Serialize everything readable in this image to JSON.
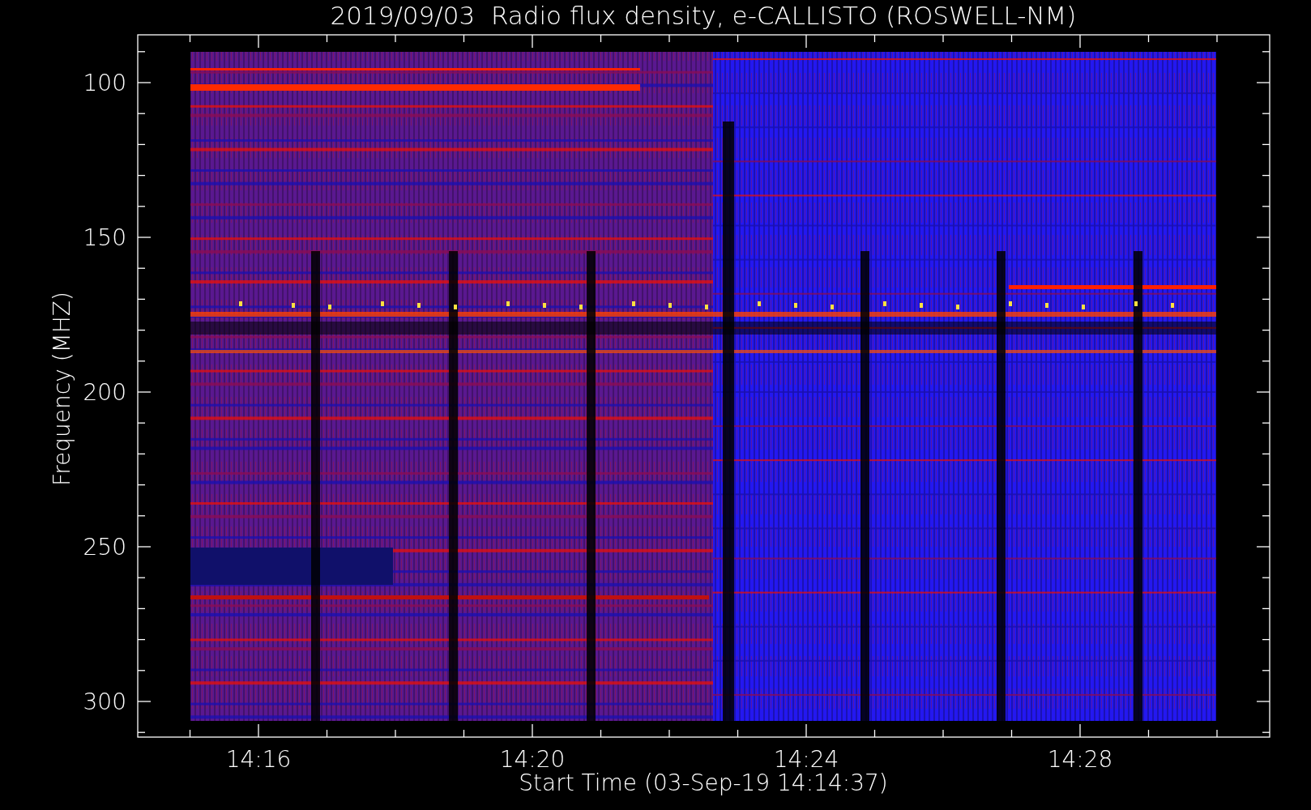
{
  "title": "2019/09/03  Radio flux density, e-CALLISTO (ROSWELL-NM)",
  "y_axis": {
    "title": "Frequency (MHZ)",
    "ticks": [
      "100",
      "150",
      "200",
      "250",
      "300"
    ]
  },
  "x_axis": {
    "title": "Start Time (03-Sep-19 14:14:37)",
    "ticks": [
      "14:16",
      "14:20",
      "14:24",
      "14:28"
    ]
  }
}
